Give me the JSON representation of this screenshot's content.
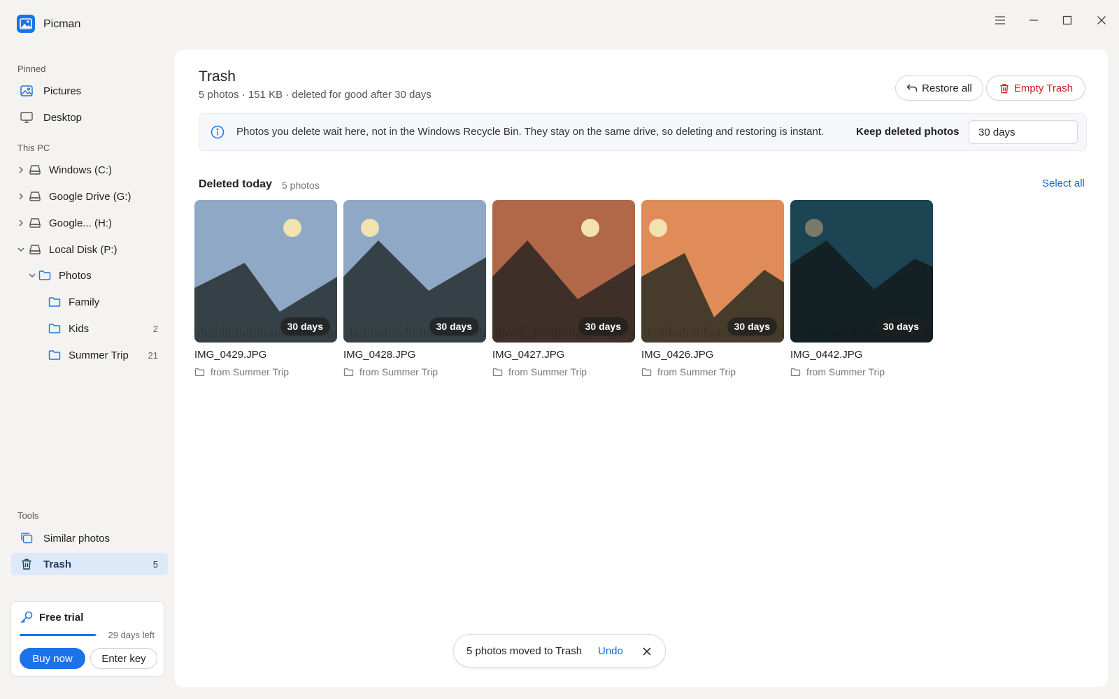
{
  "app": {
    "title": "Picman"
  },
  "sidebar": {
    "pinned_label": "Pinned",
    "pinned": [
      {
        "label": "Pictures",
        "icon": "image-icon"
      },
      {
        "label": "Desktop",
        "icon": "monitor-icon"
      }
    ],
    "thispc_label": "This PC",
    "drives": [
      {
        "label": "Windows (C:)",
        "expanded": false
      },
      {
        "label": "Google Drive (G:)",
        "expanded": false
      },
      {
        "label": "Google... (H:)",
        "expanded": false
      },
      {
        "label": "Local Disk (P:)",
        "expanded": true
      }
    ],
    "folders": [
      {
        "label": "Photos",
        "count": ""
      },
      {
        "label": "Family",
        "count": ""
      },
      {
        "label": "Kids",
        "count": "2"
      },
      {
        "label": "Summer Trip",
        "count": "21"
      }
    ],
    "tools_label": "Tools",
    "tools": [
      {
        "label": "Similar photos",
        "count": ""
      },
      {
        "label": "Trash",
        "count": "5",
        "active": true
      }
    ],
    "trial": {
      "title": "Free trial",
      "days_left": "29 days left",
      "progress": 0.97,
      "buy_label": "Buy now",
      "key_label": "Enter key"
    }
  },
  "main": {
    "title": "Trash",
    "subtitle": "5 photos · 151 KB · deleted for good after 30 days",
    "restore_label": "Restore all",
    "empty_label": "Empty Trash",
    "info_text": "Photos you delete wait here, not in the Windows Recycle Bin. They stay on the same drive, so deleting and restoring is instant.",
    "keep_label": "Keep deleted photos",
    "keep_value": "30 days",
    "group_title": "Deleted today",
    "group_count": "5 photos",
    "select_all": "Select all",
    "photos": [
      {
        "name": "IMG_0429.JPG",
        "from": "from Summer Trip",
        "days": "30 days",
        "sky": "#8ea8c6",
        "mountain": "#354146",
        "sun": "#f1e2b0"
      },
      {
        "name": "IMG_0428.JPG",
        "from": "from Summer Trip",
        "days": "30 days",
        "sky": "#8ea8c6",
        "mountain": "#354146",
        "sun": "#f1e2b0"
      },
      {
        "name": "IMG_0427.JPG",
        "from": "from Summer Trip",
        "days": "30 days",
        "sky": "#b06848",
        "mountain": "#3e3029",
        "sun": "#f1e2b0"
      },
      {
        "name": "IMG_0426.JPG",
        "from": "from Summer Trip",
        "days": "30 days",
        "sky": "#e08c58",
        "mountain": "#473b2c",
        "sun": "#f1e2b0"
      },
      {
        "name": "IMG_0442.JPG",
        "from": "from Summer Trip",
        "days": "30 days",
        "sky": "#1c4452",
        "mountain": "#142124",
        "sun": "#7a7a6c"
      }
    ]
  },
  "toast": {
    "text": "5 photos moved to Trash",
    "undo_label": "Undo"
  },
  "colors": {
    "accent": "#1a73e8",
    "danger": "#c5221f",
    "active_bg": "#dde9f8"
  }
}
